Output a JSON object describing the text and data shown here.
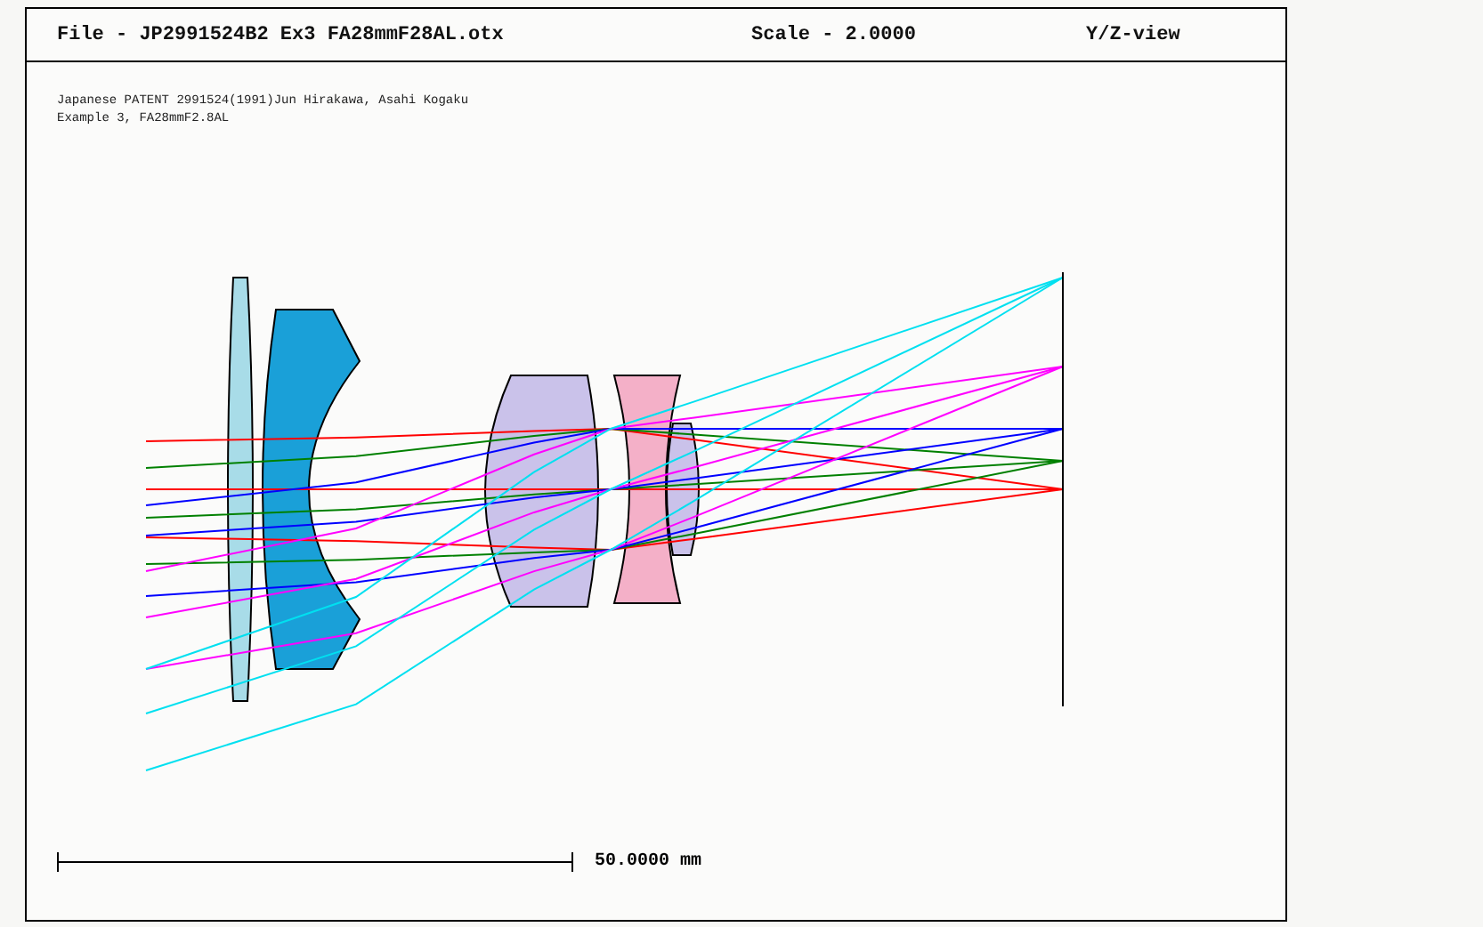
{
  "header": {
    "file_title": "File - JP2991524B2 Ex3 FA28mmF28AL.otx",
    "scale": "Scale - 2.0000",
    "view": "Y/Z-view"
  },
  "notes": [
    "Japanese PATENT 2991524(1991)Jun Hirakawa, Asahi Kogaku",
    "Example 3, FA28mmF2.8AL"
  ],
  "scale_bar": {
    "label": "50.0000 mm"
  }
}
